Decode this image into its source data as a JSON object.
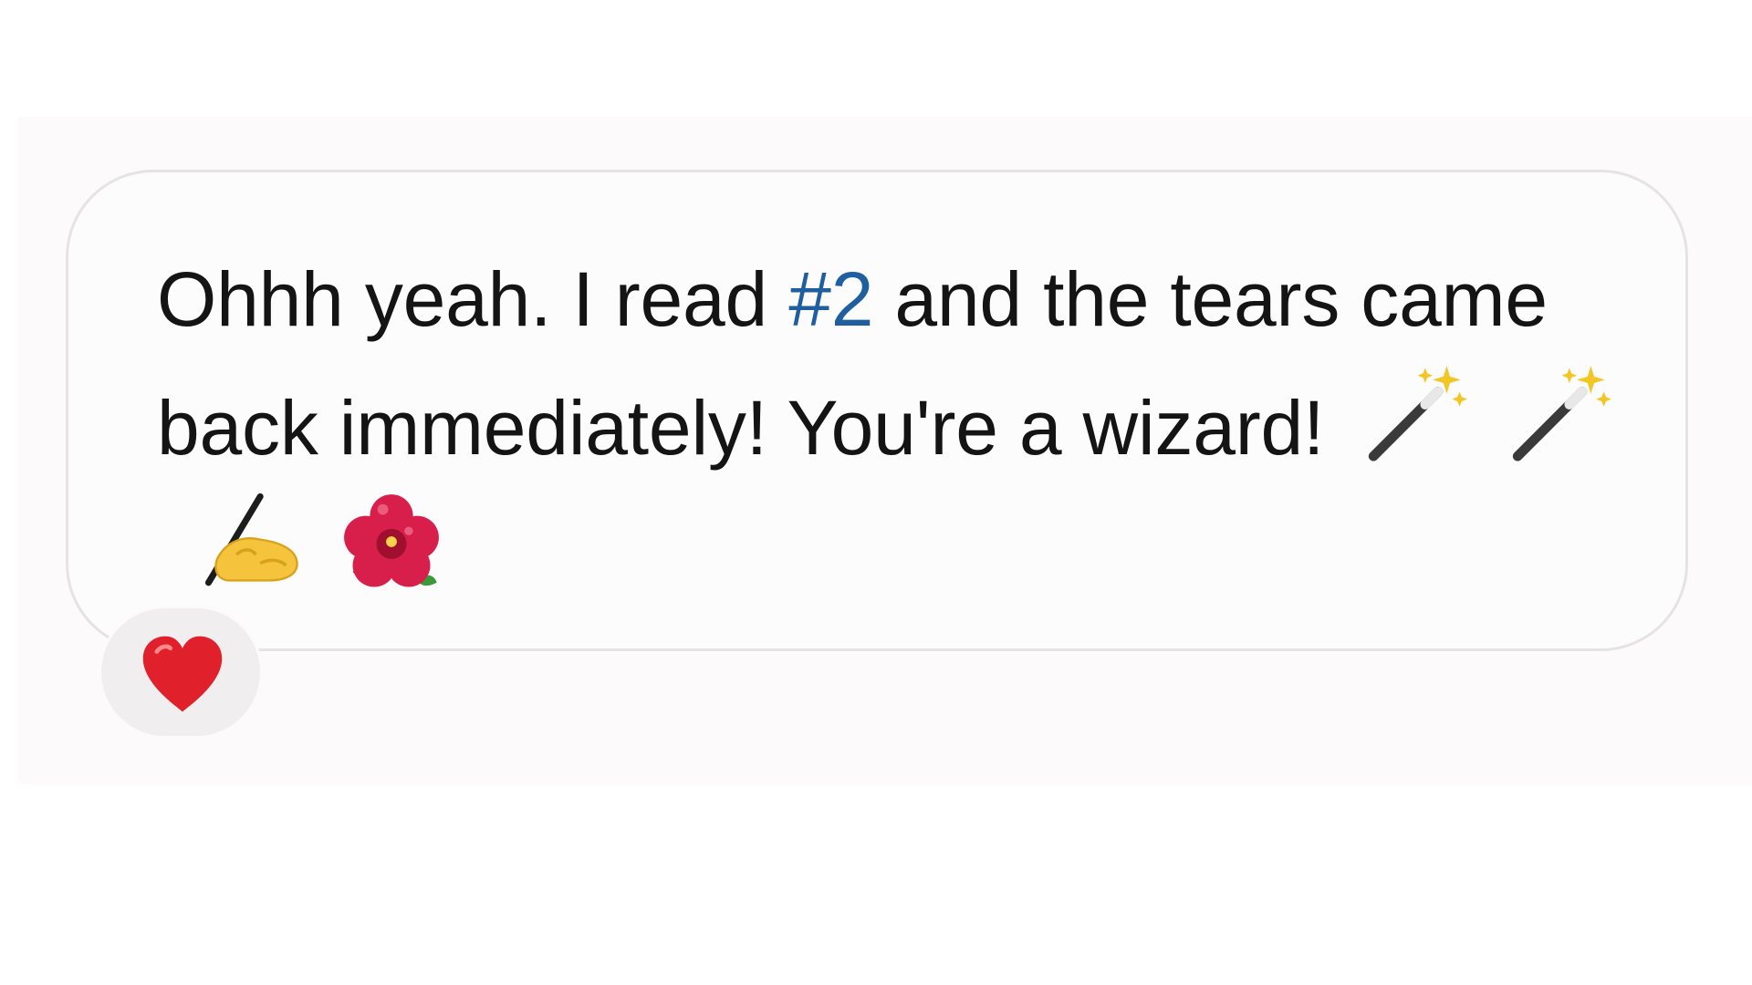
{
  "message": {
    "text_before_hashtag": "Ohhh yeah. I read ",
    "hashtag": "#2",
    "text_after_hashtag": " and the tears came back immediately! You're a wizard!",
    "emojis": [
      "magic-wand-icon",
      "magic-wand-icon",
      "writing-hand-icon",
      "hibiscus-icon"
    ]
  },
  "reaction": {
    "emoji": "red-heart-icon"
  },
  "colors": {
    "text": "#141414",
    "hashtag": "#1f5f9f",
    "bubble_border": "#e6e3e3",
    "reaction_bg": "#f0eeee",
    "heart": "#e0202a"
  }
}
